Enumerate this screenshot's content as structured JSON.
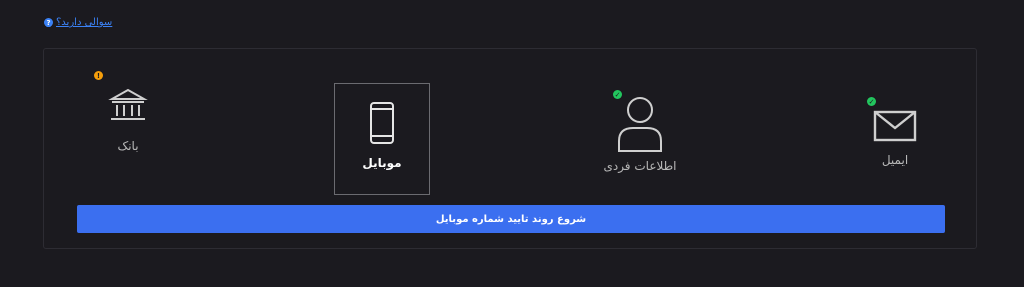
{
  "help": {
    "label": "سوالی دارید؟",
    "icon": "question-circle-icon"
  },
  "steps": [
    {
      "label": "بانک",
      "icon": "bank-icon",
      "status": "warning"
    },
    {
      "label": "موبایل",
      "icon": "mobile-icon",
      "status": "active"
    },
    {
      "label": "اطلاعات فردی",
      "icon": "user-icon",
      "status": "done"
    },
    {
      "label": "ایمیل",
      "icon": "envelope-icon",
      "status": "done"
    }
  ],
  "cta": {
    "label": "شروع روند تایید شماره موبایل"
  },
  "colors": {
    "background": "#1b1a1f",
    "accent": "#3b6ff0",
    "success": "#22c55e",
    "warning": "#f59e0b"
  }
}
